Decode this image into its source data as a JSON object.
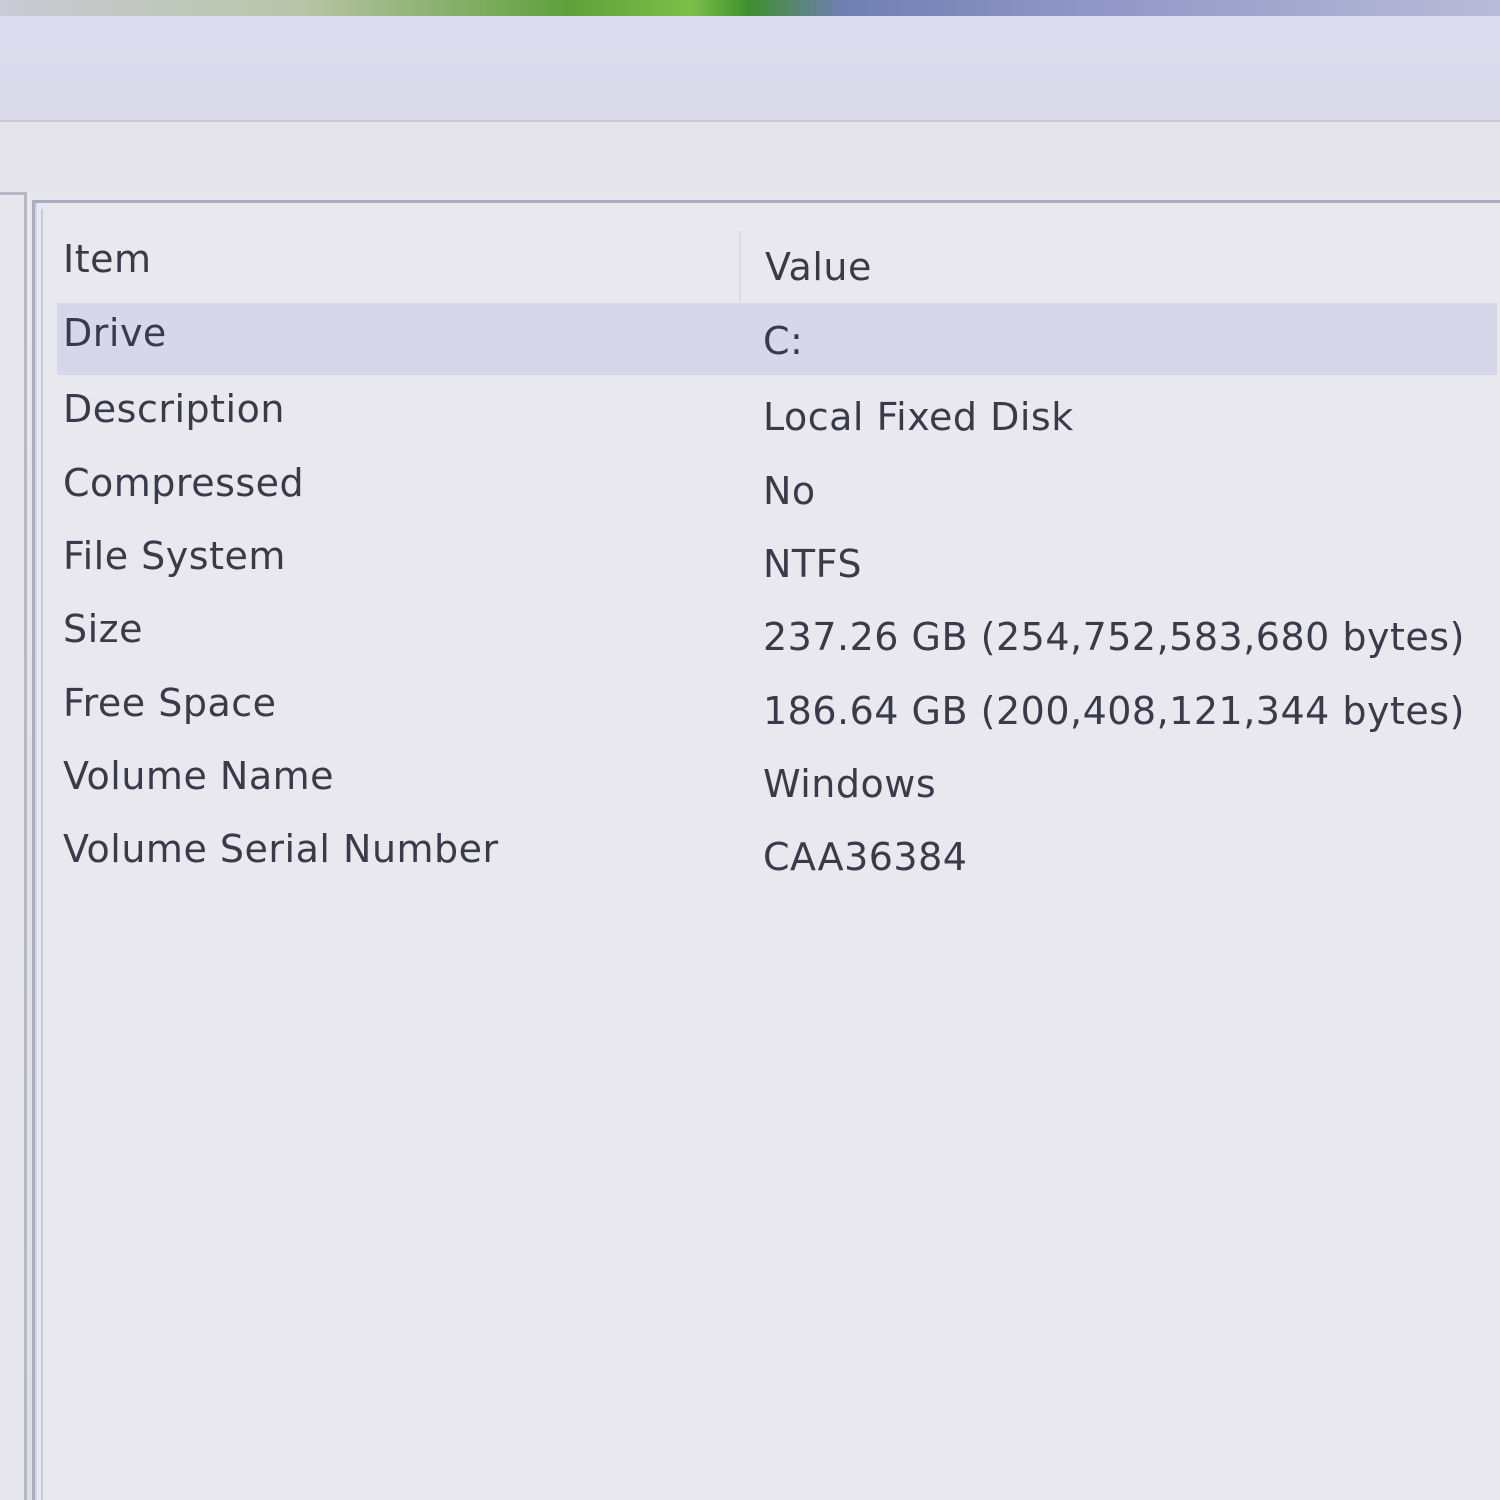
{
  "list": {
    "columns": {
      "item": "Item",
      "value": "Value"
    },
    "rows": [
      {
        "item": "Drive",
        "value": "C:"
      },
      {
        "item": "Description",
        "value": "Local Fixed Disk"
      },
      {
        "item": "Compressed",
        "value": "No"
      },
      {
        "item": "File System",
        "value": "NTFS"
      },
      {
        "item": "Size",
        "value": "237.26 GB (254,752,583,680 bytes)"
      },
      {
        "item": "Free Space",
        "value": "186.64 GB (200,408,121,344 bytes)"
      },
      {
        "item": "Volume Name",
        "value": "Windows"
      },
      {
        "item": "Volume Serial Number",
        "value": "CAA36384"
      }
    ],
    "selected_row": 0
  },
  "colors": {
    "background": "#e4e4ea",
    "selection": "#d6d7ea",
    "text": "#3a3a4a",
    "border": "#a9adc4"
  }
}
